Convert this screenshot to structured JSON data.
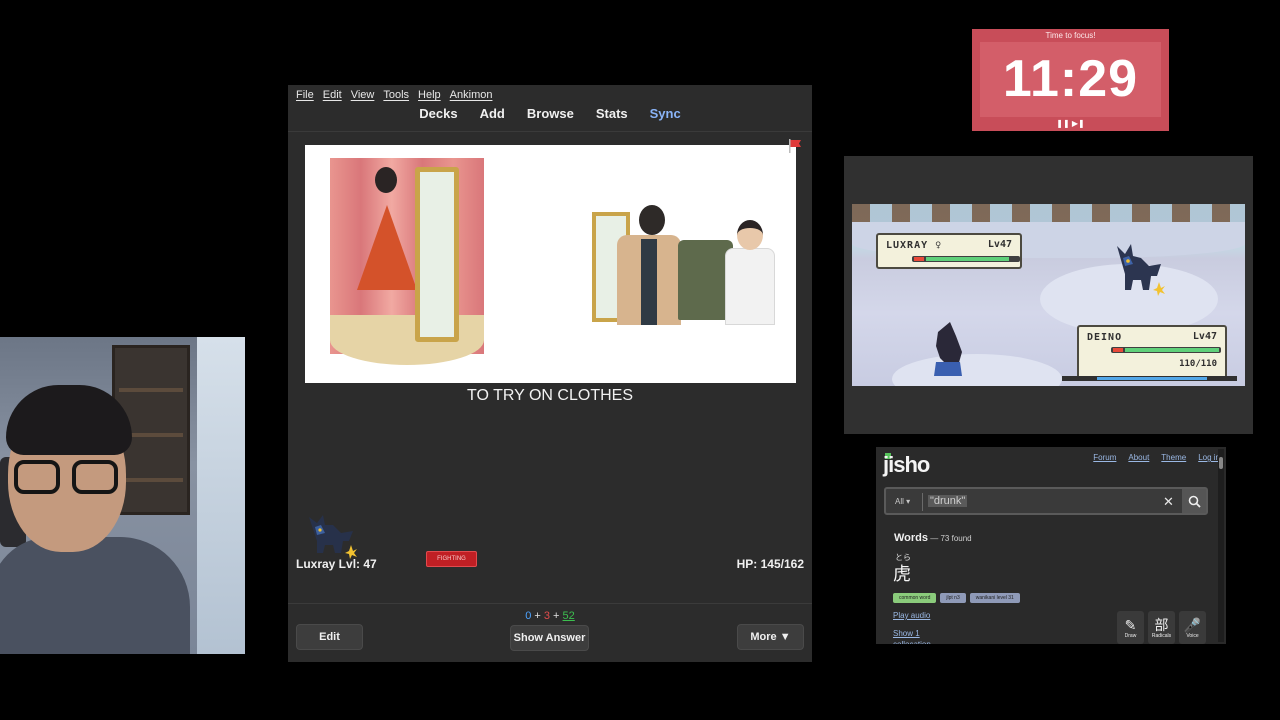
{
  "anki": {
    "menu": [
      "File",
      "Edit",
      "View",
      "Tools",
      "Help",
      "Ankimon"
    ],
    "toolbar": [
      "Decks",
      "Add",
      "Browse",
      "Stats",
      "Sync"
    ],
    "card_prompt": "TO TRY ON CLOTHES",
    "pet_name_level": "Luxray Lvl: 47",
    "status_badge": "FIGHTING",
    "hp_text": "HP: 145/162",
    "counts": {
      "new": "0",
      "plus1": " + ",
      "learn": "3",
      "plus2": " + ",
      "review": "52"
    },
    "buttons": {
      "edit": "Edit",
      "show_answer": "Show Answer",
      "more": "More ▼"
    },
    "flag_color": "#e03a3a"
  },
  "timer": {
    "label": "Time to focus!",
    "time": "11:29",
    "controls": "❚❚ ▶❚"
  },
  "game": {
    "enemy": {
      "name": "LUXRAY ♀",
      "level": "Lv47",
      "hp_fraction": 0.9
    },
    "player": {
      "name": "DEINO",
      "level": "Lv47",
      "hp": "110/110",
      "hp_fraction": 1.0,
      "exp_fraction": 0.8
    }
  },
  "jisho": {
    "logo": "jisho",
    "nav": [
      "Forum",
      "About",
      "Theme",
      "Log in"
    ],
    "search_scope": "All ▾",
    "query": "\"drunk\"",
    "clear_icon": "✕",
    "words_label": "Words",
    "found": " — 73 found",
    "furigana": "とら",
    "kanji": "虎",
    "tags": [
      "common word",
      "jlpt n3",
      "wanikani level 31"
    ],
    "links": [
      "Play audio",
      "Show 1",
      "collocation"
    ],
    "tools": [
      {
        "icon": "✎",
        "label": "Draw"
      },
      {
        "icon": "部",
        "label": "Radicals"
      },
      {
        "icon": "🎤",
        "label": "Voice"
      }
    ]
  }
}
